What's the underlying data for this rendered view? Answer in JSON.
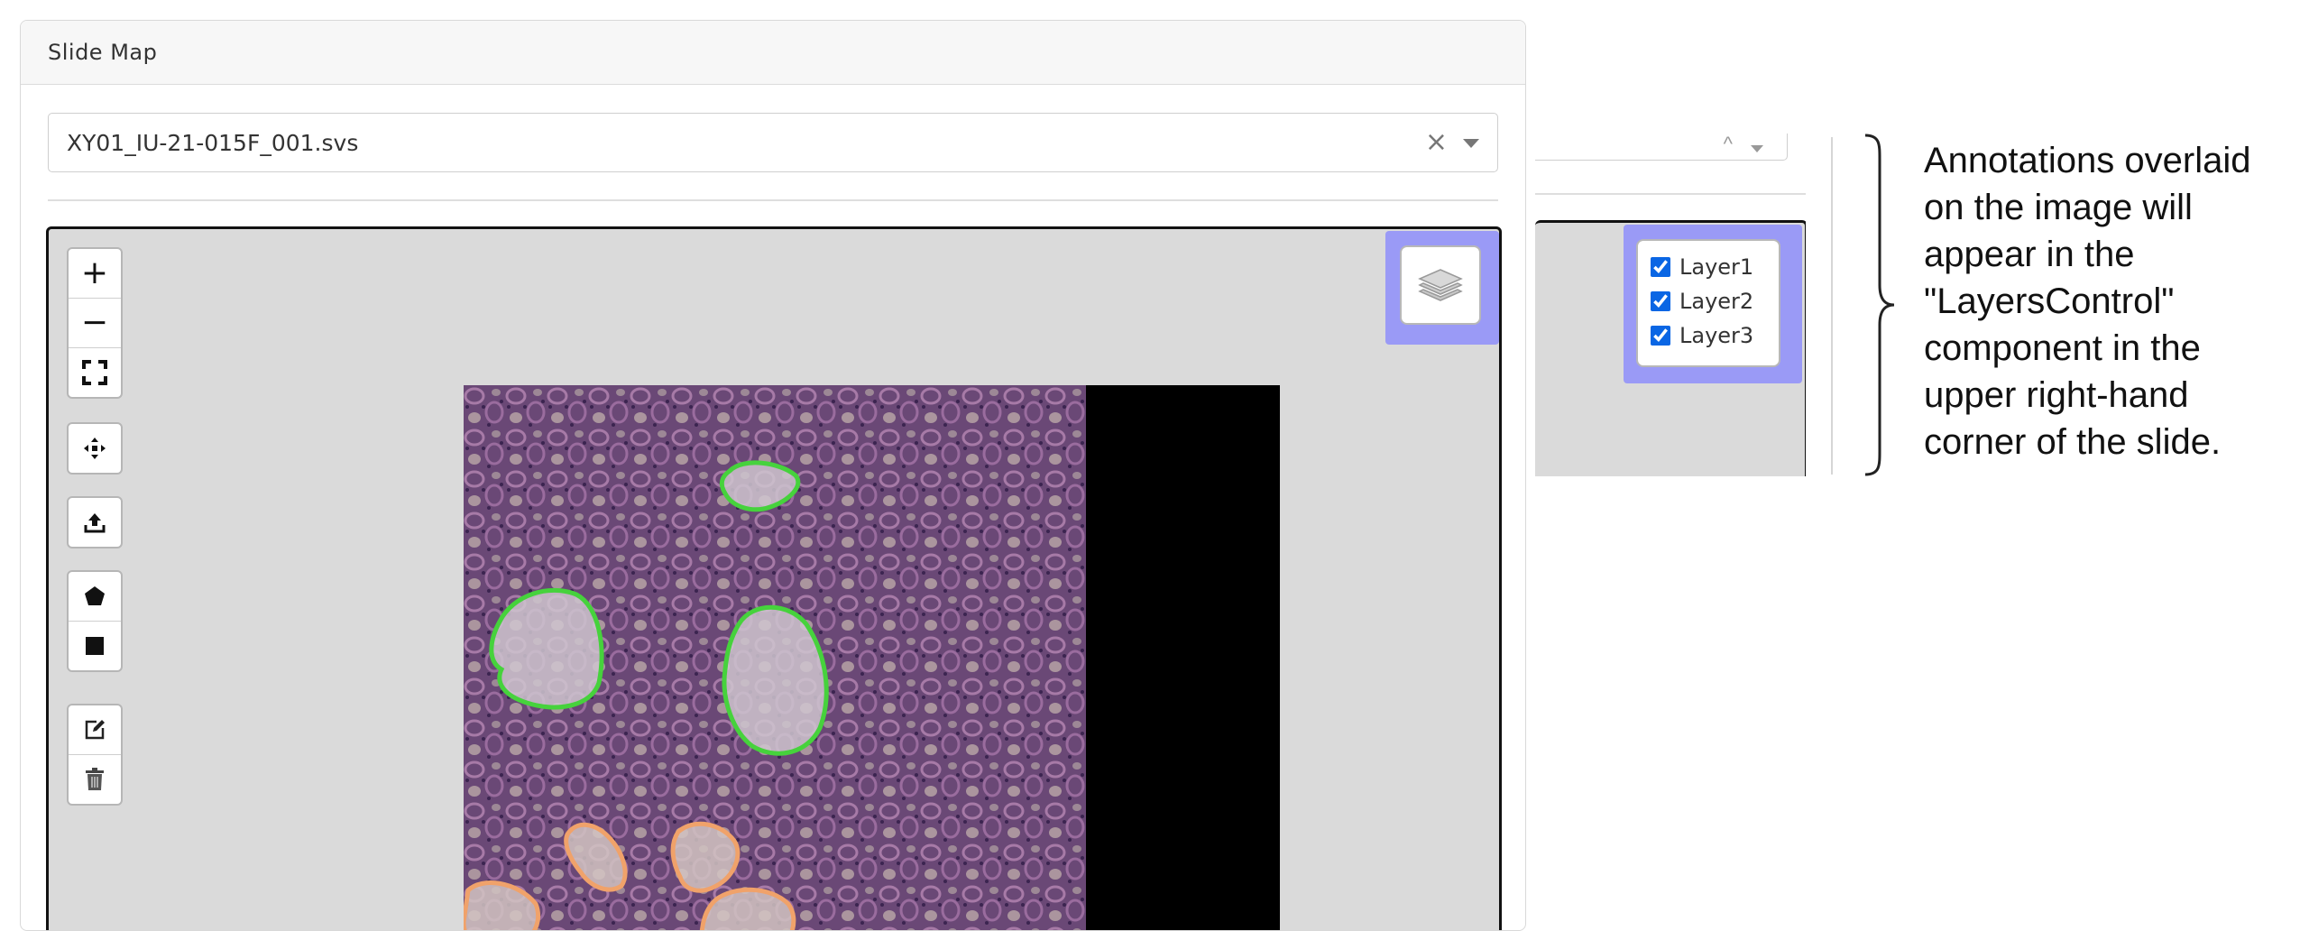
{
  "card": {
    "title": "Slide Map",
    "file_select": {
      "value": "XY01_IU-21-015F_001.svs",
      "clear_symbol": "×"
    }
  },
  "toolbar": {
    "zoom_in": "+",
    "zoom_out": "−",
    "icons": [
      "fullscreen-icon",
      "move-icon",
      "upload-icon",
      "polygon-icon",
      "rectangle-icon",
      "edit-icon",
      "trash-icon"
    ]
  },
  "layers_control": {
    "icon": "layers-icon",
    "highlight_color": "#9a9af6",
    "layers": [
      {
        "label": "Layer1",
        "checked": true
      },
      {
        "label": "Layer2",
        "checked": true
      },
      {
        "label": "Layer3",
        "checked": true
      }
    ]
  },
  "annotation_colors": {
    "green": "#46d23c",
    "orange": "#f0a26a"
  },
  "note": "Annotations overlaid on the image will appear in the \"LayersControl\" component in the upper right-hand corner of the slide."
}
